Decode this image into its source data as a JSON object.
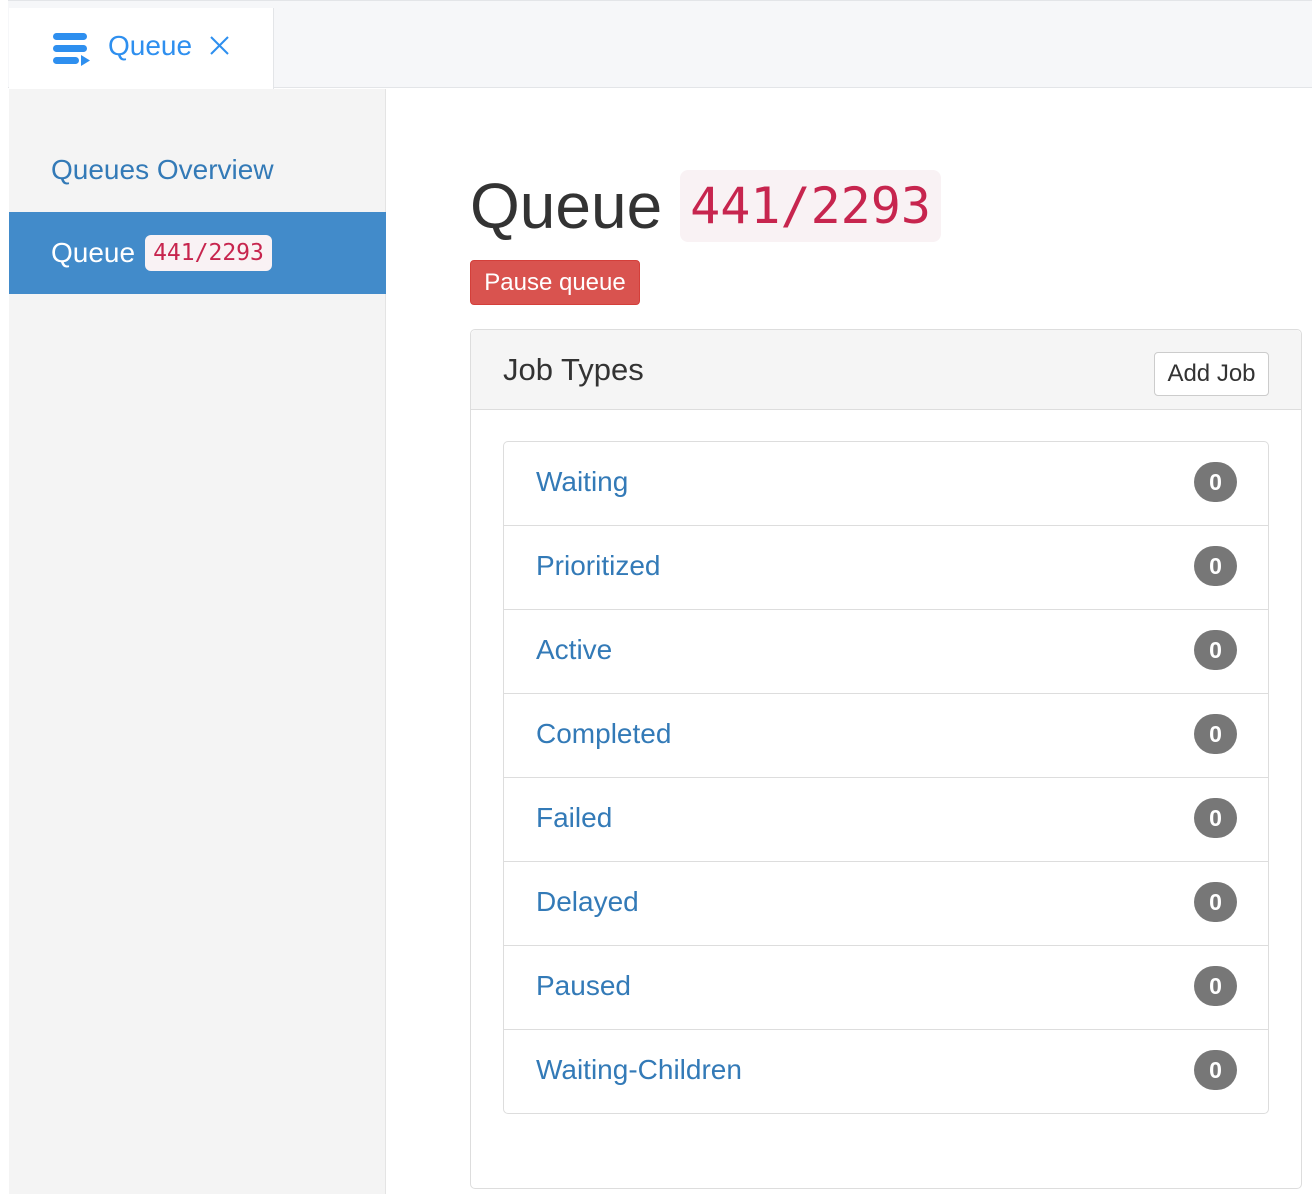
{
  "tab": {
    "label": "Queue",
    "icon": "queue-list-icon",
    "close_icon": "close-icon",
    "accent_color": "#2e8fef"
  },
  "sidebar": {
    "items": [
      {
        "label": "Queues Overview",
        "active": false
      },
      {
        "label": "Queue",
        "badge": "441/2293",
        "active": true
      }
    ],
    "active_color": "#428bca"
  },
  "main": {
    "title": "Queue",
    "title_code": "441/2293",
    "pause_label": "Pause queue",
    "pause_color": "#d9534f",
    "panel": {
      "title": "Job Types",
      "add_label": "Add Job",
      "rows": [
        {
          "label": "Waiting",
          "count": "0"
        },
        {
          "label": "Prioritized",
          "count": "0"
        },
        {
          "label": "Active",
          "count": "0"
        },
        {
          "label": "Completed",
          "count": "0"
        },
        {
          "label": "Failed",
          "count": "0"
        },
        {
          "label": "Delayed",
          "count": "0"
        },
        {
          "label": "Paused",
          "count": "0"
        },
        {
          "label": "Waiting-Children",
          "count": "0"
        }
      ]
    }
  }
}
